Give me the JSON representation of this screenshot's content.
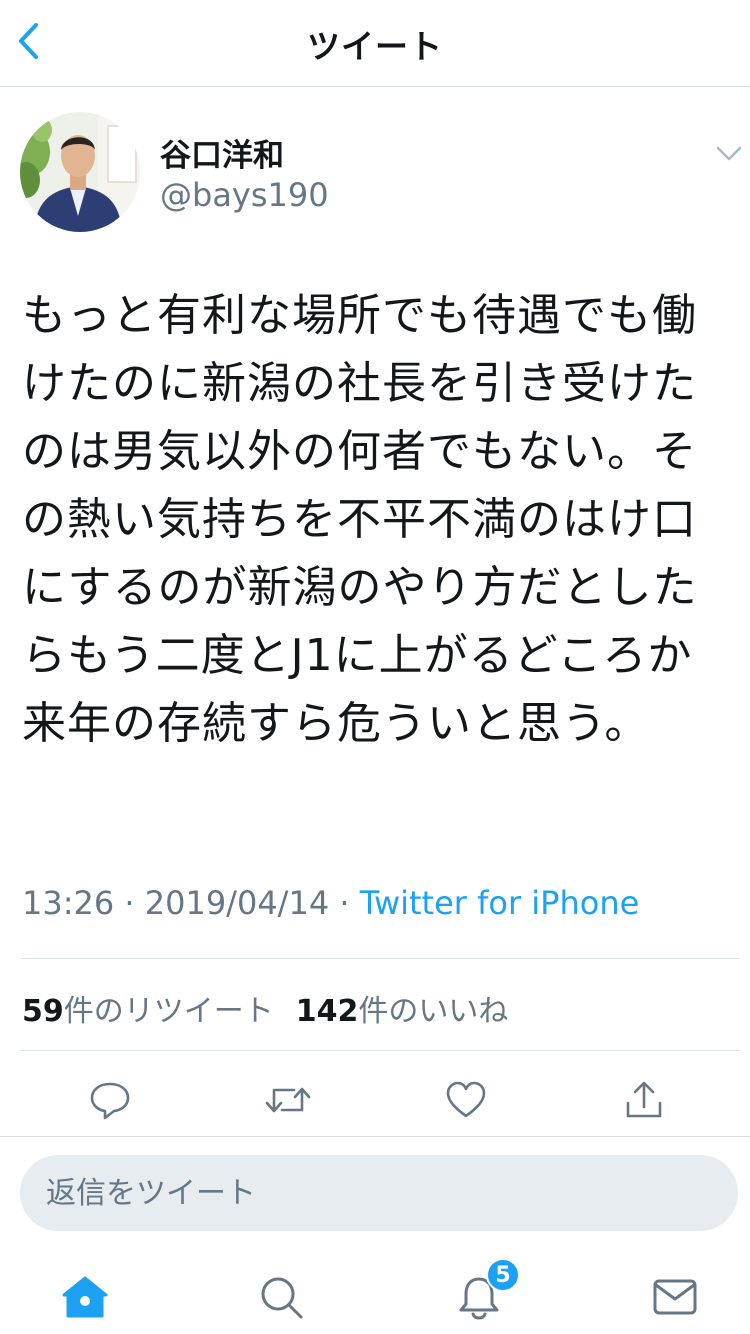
{
  "nav": {
    "title": "ツイート",
    "back_icon": "chevron-left-icon"
  },
  "author": {
    "display_name": "谷口洋和",
    "handle": "@bays190",
    "avatar_icon": "user-avatar",
    "menu_icon": "chevron-down-icon"
  },
  "tweet": {
    "text": "もっと有利な場所でも待遇でも働けたのに新潟の社長を引き受けたのは男気以外の何者でもない。その熱い気持ちを不平不満のはけ口にするのが新潟のやり方だとしたらもう二度とJ1に上がるどころか来年の存続すら危ういと思う。",
    "time": "13:26",
    "date": "2019/04/14",
    "separator": "·",
    "source": "Twitter for iPhone"
  },
  "stats": {
    "retweet_count": "59",
    "retweet_label": "件のリツイート",
    "like_count": "142",
    "like_label": "件のいいね"
  },
  "actions": {
    "reply_icon": "reply-icon",
    "retweet_icon": "retweet-icon",
    "like_icon": "heart-icon",
    "share_icon": "share-icon"
  },
  "reply": {
    "placeholder": "返信をツイート"
  },
  "tabbar": {
    "home_icon": "home-icon",
    "search_icon": "search-icon",
    "notifications_icon": "bell-icon",
    "notifications_badge": "5",
    "messages_icon": "mail-icon"
  },
  "colors": {
    "accent": "#1da1f2",
    "text": "#14171a",
    "secondary": "#657786",
    "border": "#e1e8ed",
    "input_bg": "#e6ecf0"
  }
}
